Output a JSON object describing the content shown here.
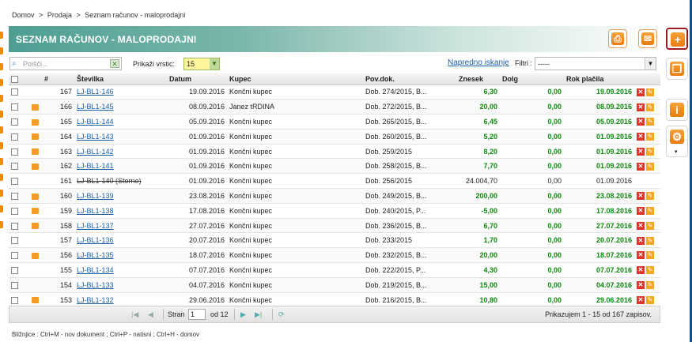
{
  "breadcrumb": [
    "Domov",
    ">",
    "Prodaja",
    ">",
    "Seznam računov - maloprodajni"
  ],
  "title": "SEZNAM RAČUNOV - MALOPRODAJNI",
  "search": {
    "placeholder": "Poišči..."
  },
  "rows_label": "Prikaži vrstic:",
  "rows_value": "15",
  "advanced_search": "Napredno iskanje",
  "filters_label": "Filtri :",
  "filters_value": "-----",
  "columns": [
    "#",
    "Številka",
    "Datum",
    "Kupec",
    "Pov.dok.",
    "Znesek",
    "Dolg",
    "Rok plačila"
  ],
  "rows": [
    {
      "num": "167",
      "stevilka": "LJ-BL1-146",
      "datum": "19.09.2016",
      "kupec": "Končni kupec",
      "povdok": "Dob. 274/2015, B...",
      "znesek": "6,30",
      "dolg": "0,00",
      "rok": "19.09.2016",
      "print": false,
      "storno": false
    },
    {
      "num": "166",
      "stevilka": "LJ-BL1-145",
      "datum": "08.09.2016",
      "kupec": "Janez tRDINA",
      "povdok": "Dob. 272/2015, B...",
      "znesek": "20,00",
      "dolg": "0,00",
      "rok": "08.09.2016",
      "print": true,
      "storno": false
    },
    {
      "num": "165",
      "stevilka": "LJ-BL1-144",
      "datum": "05.09.2016",
      "kupec": "Končni kupec",
      "povdok": "Dob. 265/2015, B...",
      "znesek": "6,45",
      "dolg": "0,00",
      "rok": "05.09.2016",
      "print": true,
      "storno": false
    },
    {
      "num": "164",
      "stevilka": "LJ-BL1-143",
      "datum": "01.09.2016",
      "kupec": "Končni kupec",
      "povdok": "Dob. 260/2015, B...",
      "znesek": "5,20",
      "dolg": "0,00",
      "rok": "01.09.2016",
      "print": true,
      "storno": false
    },
    {
      "num": "163",
      "stevilka": "LJ-BL1-142",
      "datum": "01.09.2016",
      "kupec": "Končni kupec",
      "povdok": "Dob. 259/2015",
      "znesek": "8,20",
      "dolg": "0,00",
      "rok": "01.09.2016",
      "print": true,
      "storno": false
    },
    {
      "num": "162",
      "stevilka": "LJ-BL1-141",
      "datum": "01.09.2016",
      "kupec": "Končni kupec",
      "povdok": "Dob. 258/2015, B...",
      "znesek": "7,70",
      "dolg": "0,00",
      "rok": "01.09.2016",
      "print": true,
      "storno": false
    },
    {
      "num": "161",
      "stevilka": "LJ-BL1-140 (Storno)",
      "datum": "01.09.2016",
      "kupec": "Končni kupec",
      "povdok": "Dob. 256/2015",
      "znesek": "24.004,70",
      "dolg": "0,00",
      "rok": "01.09.2016",
      "print": false,
      "storno": true
    },
    {
      "num": "160",
      "stevilka": "LJ-BL1-139",
      "datum": "23.08.2016",
      "kupec": "Končni kupec",
      "povdok": "Dob. 249/2015, B...",
      "znesek": "200,00",
      "dolg": "0,00",
      "rok": "23.08.2016",
      "print": true,
      "storno": false
    },
    {
      "num": "159",
      "stevilka": "LJ-BL1-138",
      "datum": "17.08.2016",
      "kupec": "Končni kupec",
      "povdok": "Dob. 240/2015, P...",
      "znesek": "-5,00",
      "dolg": "0,00",
      "rok": "17.08.2016",
      "print": true,
      "storno": false
    },
    {
      "num": "158",
      "stevilka": "LJ-BL1-137",
      "datum": "27.07.2016",
      "kupec": "Končni kupec",
      "povdok": "Dob. 236/2015, B...",
      "znesek": "6,70",
      "dolg": "0,00",
      "rok": "27.07.2016",
      "print": true,
      "storno": false
    },
    {
      "num": "157",
      "stevilka": "LJ-BL1-136",
      "datum": "20.07.2016",
      "kupec": "Končni kupec",
      "povdok": "Dob. 233/2015",
      "znesek": "1,70",
      "dolg": "0,00",
      "rok": "20.07.2016",
      "print": false,
      "storno": false
    },
    {
      "num": "156",
      "stevilka": "LJ-BL1-135",
      "datum": "18.07.2016",
      "kupec": "Končni kupec",
      "povdok": "Dob. 232/2015, B...",
      "znesek": "20,00",
      "dolg": "0,00",
      "rok": "18.07.2016",
      "print": true,
      "storno": false
    },
    {
      "num": "155",
      "stevilka": "LJ-BL1-134",
      "datum": "07.07.2016",
      "kupec": "Končni kupec",
      "povdok": "Dob. 222/2015, P...",
      "znesek": "4,30",
      "dolg": "0,00",
      "rok": "07.07.2016",
      "print": false,
      "storno": false
    },
    {
      "num": "154",
      "stevilka": "LJ-BL1-133",
      "datum": "04.07.2016",
      "kupec": "Končni kupec",
      "povdok": "Dob. 219/2015, B...",
      "znesek": "15,00",
      "dolg": "0,00",
      "rok": "04.07.2016",
      "print": false,
      "storno": false
    },
    {
      "num": "153",
      "stevilka": "LJ-BL1-132",
      "datum": "29.06.2016",
      "kupec": "Končni kupec",
      "povdok": "Dob. 216/2015, B...",
      "znesek": "10,80",
      "dolg": "0,00",
      "rok": "29.06.2016",
      "print": true,
      "storno": false
    }
  ],
  "pager": {
    "page_label": "Stran",
    "page_value": "1",
    "of_label": "od 12",
    "info": "Prikazujem 1 - 15 od 167 zapisov."
  },
  "footer": "Bližnjice : Ctrl+M - nov dokument ;   Ctrl+P - natisni ;   Ctrl+H - domov",
  "colors": {
    "accent": "#f08a00",
    "green": "#0a8a0a",
    "link": "#1a5ea8",
    "header_teal": "#4e9e93"
  },
  "icons": [
    "print-icon",
    "email-icon",
    "add-icon",
    "copy-icon",
    "info-icon",
    "settings-icon",
    "search-icon",
    "clear-icon",
    "delete-icon",
    "edit-icon",
    "refresh-icon"
  ]
}
